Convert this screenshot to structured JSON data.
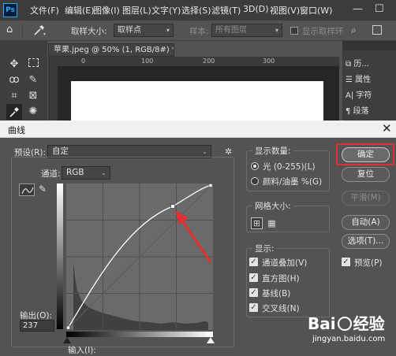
{
  "menubar": {
    "logo": "Ps",
    "items": [
      "文件(F)",
      "编辑(E)",
      "图像(I)",
      "图层(L)",
      "文字(Y)",
      "选择(S)",
      "滤镜(T)",
      "3D(D)",
      "视图(V)",
      "窗口(W)"
    ],
    "window_controls": [
      "—",
      "☐"
    ]
  },
  "options_bar": {
    "sample_size_label": "取样大小:",
    "sample_size_value": "取样点",
    "sample_label": "样本:",
    "sample_value": "所有图层",
    "show_ring_label": "显示取样环"
  },
  "document": {
    "tab_title": "苹果.jpeg @ 50% (1, RGB/8#) *",
    "tab_close": "×",
    "ruler_marks": [
      "0",
      "100",
      "200",
      "300"
    ]
  },
  "right_panel": {
    "items": [
      "历...",
      "属性",
      "字符",
      "段落"
    ]
  },
  "dialog": {
    "title": "曲线",
    "close": "✕",
    "preset_label": "预设(R):",
    "preset_value": "自定",
    "channel_label": "通道:",
    "channel_value": "RGB",
    "output_label": "输出(O):",
    "output_value": "237",
    "input_label": "输入(I):",
    "display_amount_title": "显示数量:",
    "light_option": "光 (0-255)(L)",
    "pigment_option": "颜料/油墨 %(G)",
    "grid_size_title": "网格大小:",
    "show_title": "显示:",
    "show_options": [
      "通道叠加(V)",
      "直方图(H)",
      "基线(B)",
      "交叉线(N)"
    ],
    "buttons": {
      "ok": "确定",
      "reset": "复位",
      "smooth": "平滑(M)",
      "auto": "自动(A)",
      "options": "选项(T)..."
    },
    "preview_label": "预览(P)",
    "colors": {
      "highlight": "#e03030",
      "curve": "#ffffff"
    }
  },
  "watermark": {
    "brand_left": "Bai",
    "brand_right": "经验",
    "url": "jingyan.baidu.com"
  }
}
